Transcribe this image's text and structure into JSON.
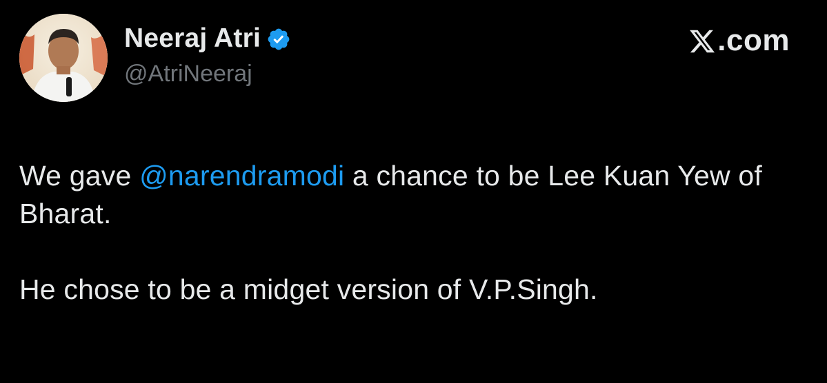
{
  "author": {
    "display_name": "Neeraj Atri",
    "handle": "@AtriNeeraj",
    "verified": true,
    "avatar": "avatar-photo"
  },
  "brand": {
    "logo": "x-logo-icon",
    "suffix": ".com"
  },
  "tweet": {
    "line1_pre": "We gave ",
    "mention": "@narendramodi",
    "line1_post": " a chance to be Lee Kuan Yew of Bharat.",
    "paragraph2": "He chose to be a midget version of V.P.Singh."
  },
  "colors": {
    "background": "#000000",
    "text": "#e7e9ea",
    "secondary": "#71767b",
    "link": "#1d9bf0"
  }
}
